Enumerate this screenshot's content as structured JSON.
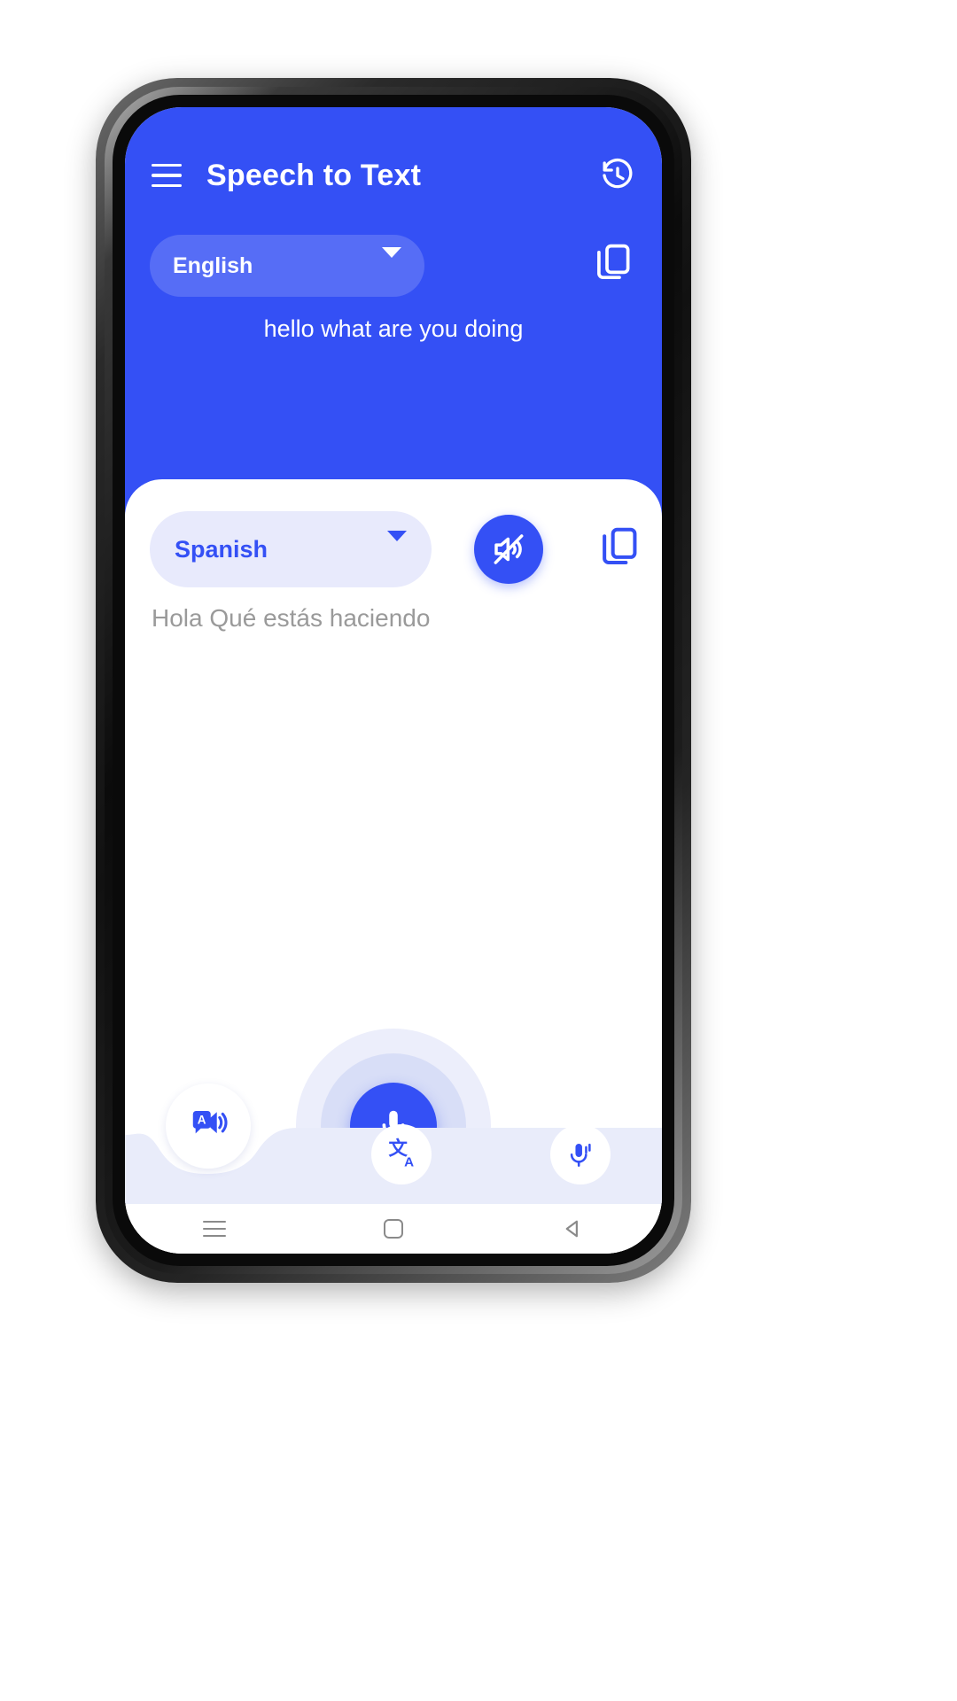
{
  "app": {
    "title": "Speech to Text",
    "theme": {
      "primary": "#3450f5",
      "pill_light": "#e8eafc",
      "halo_outer": "#e4e7fa",
      "halo_inner": "#d5daf6",
      "nav_bar": "#e9ecfa",
      "muted_text": "#9a9a9a"
    }
  },
  "appbar": {
    "menu_icon": "hamburger-menu-icon",
    "title": "Speech to Text",
    "history_icon": "history-clock-icon"
  },
  "source": {
    "language": "English",
    "dropdown_icon": "chevron-down-icon",
    "copy_icon": "copy-icon",
    "text": "hello what are you doing"
  },
  "target": {
    "language": "Spanish",
    "dropdown_icon": "chevron-down-icon",
    "mute_icon": "speaker-mute-icon",
    "copy_icon": "copy-icon",
    "text": "Hola Qué estás haciendo"
  },
  "mic": {
    "icon": "microphone-icon",
    "state": "idle"
  },
  "bottom_nav": {
    "items": [
      {
        "name": "text-to-speech",
        "icon": "speech-bubble-speaker-icon"
      },
      {
        "name": "translate",
        "icon": "translate-icon"
      },
      {
        "name": "voice-input",
        "icon": "microphone-wave-icon"
      }
    ]
  },
  "system_nav": {
    "recents_icon": "recents-icon",
    "home_icon": "home-icon",
    "back_icon": "back-icon"
  }
}
